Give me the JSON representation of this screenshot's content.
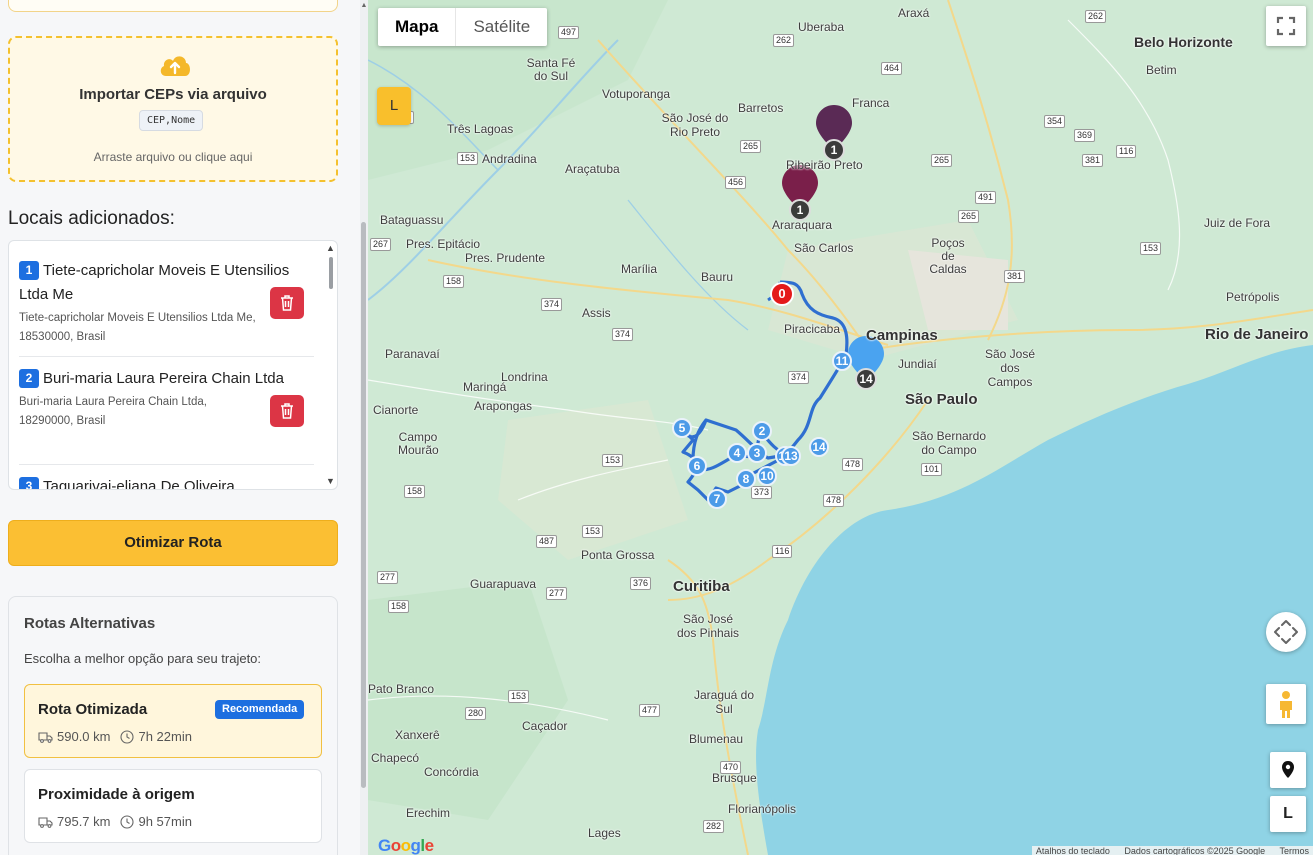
{
  "importer": {
    "title": "Importar CEPs via arquivo",
    "format": "CEP,Nome",
    "hint": "Arraste arquivo ou clique aqui"
  },
  "locations_section": {
    "title": "Locais adicionados:",
    "items": [
      {
        "number": "1",
        "name": "Tiete-capricholar Moveis E Utensilios Ltda Me",
        "address": "Tiete-capricholar Moveis E Utensilios Ltda Me, 18530000, Brasil"
      },
      {
        "number": "2",
        "name": "Buri-maria Laura Pereira Chain Ltda",
        "address": "Buri-maria Laura Pereira Chain Ltda, 18290000, Brasil"
      },
      {
        "number": "3",
        "name": "Taquarivai-eliana De Oliveira",
        "address": ""
      }
    ]
  },
  "optimize_button": "Otimizar Rota",
  "alt_routes": {
    "title": "Rotas Alternativas",
    "subtitle": "Escolha a melhor opção para seu trajeto:",
    "options": [
      {
        "name": "Rota Otimizada",
        "badge": "Recomendada",
        "distance": "590.0 km",
        "duration": "7h 22min",
        "selected": true
      },
      {
        "name": "Proximidade à origem",
        "badge": "",
        "distance": "795.7 km",
        "duration": "9h 57min",
        "selected": false
      }
    ]
  },
  "map": {
    "type_buttons": [
      "Mapa",
      "Satélite"
    ],
    "active_type": "Mapa",
    "overlay_badge": "L",
    "control_l": "L",
    "google": "Google",
    "attribution": [
      "Atalhos do teclado",
      "Dados cartográficos ©2025 Google",
      "Termos"
    ],
    "origin_label": "0",
    "pins": [
      {
        "label": "1",
        "color": "#5a2a55"
      },
      {
        "label": "1",
        "color": "#7a1f4a"
      },
      {
        "label": "14",
        "color": "#4aa3f0"
      }
    ],
    "stops": [
      "2",
      "3",
      "4",
      "5",
      "6",
      "7",
      "8",
      "10",
      "12",
      "13",
      "14",
      "11"
    ],
    "cities": [
      "Uberaba",
      "Araxá",
      "Belo Horizonte",
      "Betim",
      "Franca",
      "Ribeirão Preto",
      "Barretos",
      "Votuporanga",
      "São José do Rio Preto",
      "Santa Fé do Sul",
      "Três Lagoas",
      "Andradina",
      "Araçatuba",
      "Araraquara",
      "São Carlos",
      "Poços de Caldas",
      "Juiz de Fora",
      "Bataguassu",
      "Pres. Epitácio",
      "Pres. Prudente",
      "Marília",
      "Bauru",
      "Assis",
      "Piracicaba",
      "Campinas",
      "Jundiaí",
      "São José dos Campos",
      "Rio de Janeiro",
      "Petrópolis",
      "São Paulo",
      "São Bernardo do Campo",
      "Paranavaí",
      "Maringá",
      "Londrina",
      "Arapongas",
      "Cianorte",
      "Campo Mourão",
      "Ponta Grossa",
      "Guarapuava",
      "Curitiba",
      "São José dos Pinhais",
      "Pato Branco",
      "Blumenau",
      "Brusque",
      "Xanxerê",
      "Chapecó",
      "Concórdia",
      "Caçador",
      "Erechim",
      "Lages",
      "Florianópolis",
      "Jaraguá do Sul"
    ],
    "roads": [
      "497",
      "262",
      "464",
      "262",
      "354",
      "369",
      "381",
      "153",
      "265",
      "456",
      "265",
      "491",
      "267",
      "158",
      "381",
      "374",
      "374",
      "374",
      "153",
      "153",
      "487",
      "158",
      "373",
      "478",
      "478",
      "101",
      "116",
      "153",
      "277",
      "277",
      "376",
      "158",
      "153",
      "280",
      "477",
      "282",
      "470",
      "262",
      "116",
      "153",
      "265"
    ]
  },
  "colors": {
    "accent": "#fbbf33",
    "primary": "#1d6fe0",
    "danger": "#dc3545",
    "route": "#3574d4",
    "water": "#8fd3e5",
    "land": "#cfe9d4"
  }
}
